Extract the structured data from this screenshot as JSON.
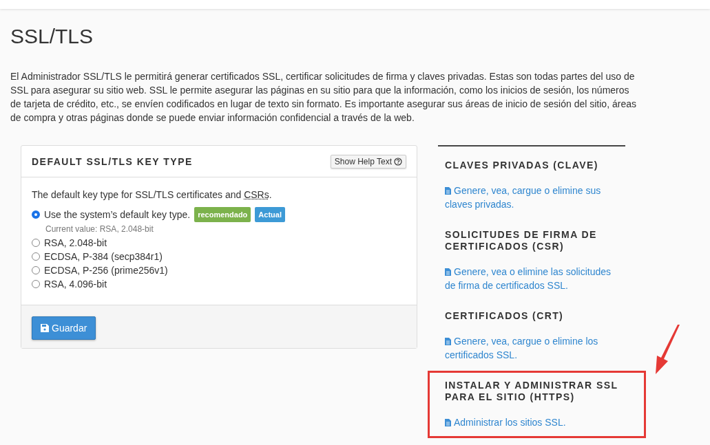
{
  "page_title": "SSL/TLS",
  "intro": "El Administrador SSL/TLS le permitirá generar certificados SSL, certificar solicitudes de firma y claves privadas. Estas son todas partes del uso de SSL para asegurar su sitio web. SSL le permite asegurar las páginas en su sitio para que la información, como los inicios de sesión, los números de tarjeta de crédito, etc., se envíen codificados en lugar de texto sin formato. Es importante asegurar sus áreas de inicio de sesión del sitio, áreas de compra y otras páginas donde se puede enviar información confidencial a través de la web.",
  "panel": {
    "title": "DEFAULT SSL/TLS KEY TYPE",
    "help_button": "Show Help Text",
    "description": {
      "before": "The default key type for SSL/TLS certificates and ",
      "abbr": "CSRs",
      "after": "."
    },
    "options": [
      {
        "label": "Use the system’s default key type.",
        "selected": true,
        "badges": [
          {
            "text": "recomendado",
            "color": "#7cb24c"
          },
          {
            "text": "Actual",
            "color": "#3d9ad6"
          }
        ],
        "note": "Current value: RSA, 2.048-bit"
      },
      {
        "label": "RSA, 2.048-bit",
        "selected": false
      },
      {
        "label": "ECDSA, P-384 (secp384r1)",
        "selected": false
      },
      {
        "label": "ECDSA, P-256 (prime256v1)",
        "selected": false
      },
      {
        "label": "RSA, 4.096-bit",
        "selected": false
      }
    ],
    "save_button": "Guardar"
  },
  "sections": [
    {
      "heading": "CLAVES PRIVADAS (CLAVE)",
      "link": "Genere, vea, cargue o elimine sus claves privadas.",
      "highlighted": false
    },
    {
      "heading": "SOLICITUDES DE FIRMA DE CERTIFICADOS (CSR)",
      "link": "Genere, vea o elimine las solicitudes de firma de certificados SSL.",
      "highlighted": false
    },
    {
      "heading": "CERTIFICADOS (CRT)",
      "link": "Genere, vea, cargue o elimine los certificados SSL.",
      "highlighted": false
    },
    {
      "heading": "INSTALAR Y ADMINISTRAR SSL PARA EL SITIO (HTTPS)",
      "link": "Administrar los sitios SSL.",
      "highlighted": true
    }
  ]
}
